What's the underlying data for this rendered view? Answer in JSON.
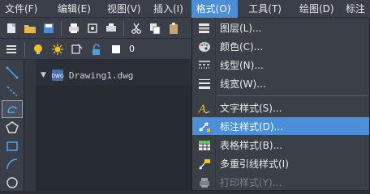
{
  "menubar": {
    "items": [
      {
        "label": "文件(F)"
      },
      {
        "label": "编辑(E)"
      },
      {
        "label": "视图(V)"
      },
      {
        "label": "插入(I)"
      },
      {
        "label": "格式(O)"
      },
      {
        "label": "工具(T)"
      },
      {
        "label": "绘图(D)"
      },
      {
        "label": "标注"
      }
    ],
    "active": "格式(O)"
  },
  "layer_toolbar": {
    "current_layer": "0"
  },
  "document": {
    "tab_name": "Drawing1.dwg",
    "dwg_badge": "DWG"
  },
  "format_menu": {
    "items": [
      {
        "label": "图层(L)...",
        "icon": "layers-icon"
      },
      {
        "label": "颜色(C)...",
        "icon": "color-palette-icon"
      },
      {
        "label": "线型(N)...",
        "icon": "linetype-icon"
      },
      {
        "label": "线宽(W)...",
        "icon": "lineweight-icon"
      },
      {
        "label": "文字样式(S)...",
        "icon": "text-style-icon"
      },
      {
        "label": "标注样式(D)...",
        "icon": "dimension-style-icon",
        "highlighted": true
      },
      {
        "label": "表格样式(B)...",
        "icon": "table-style-icon"
      },
      {
        "label": "多重引线样式(I)",
        "icon": "multileader-style-icon"
      },
      {
        "label": "打印样式(Y)...",
        "icon": "plot-style-icon",
        "disabled": true
      }
    ]
  },
  "colors": {
    "accent": "#4a8fd8",
    "menubar_bg": "#3a3f4a",
    "canvas_bg": "#262a31"
  }
}
